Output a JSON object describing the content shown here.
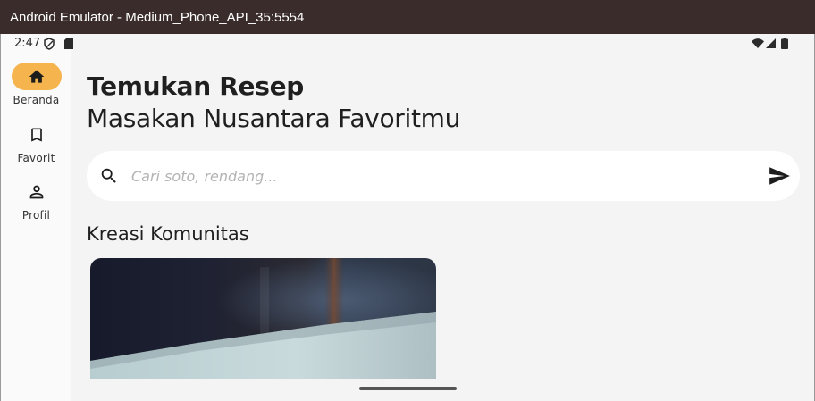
{
  "window": {
    "title": "Android Emulator - Medium_Phone_API_35:5554"
  },
  "status_bar": {
    "time": "2:47"
  },
  "nav_rail": {
    "items": [
      {
        "label": "Beranda",
        "icon": "home-icon",
        "active": true
      },
      {
        "label": "Favorit",
        "icon": "bookmark-icon",
        "active": false
      },
      {
        "label": "Profil",
        "icon": "person-icon",
        "active": false
      }
    ],
    "active_color": "#f5b44d"
  },
  "header": {
    "title": "Temukan Resep",
    "subtitle": "Masakan Nusantara Favoritmu"
  },
  "search": {
    "placeholder": "Cari soto, rendang...",
    "value": ""
  },
  "community": {
    "title": "Kreasi Komunitas"
  }
}
